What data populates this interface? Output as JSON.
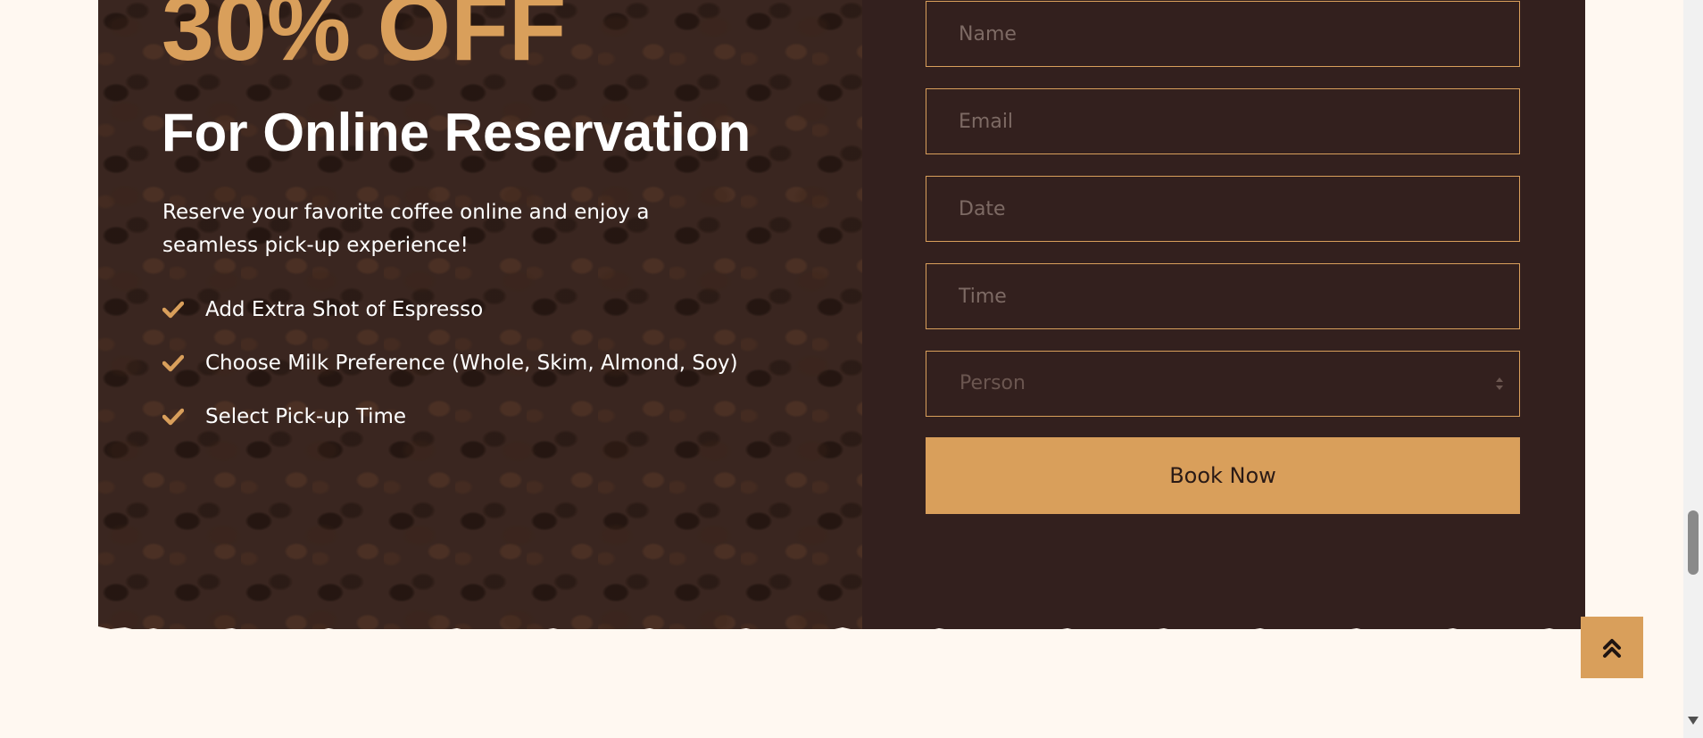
{
  "promo": {
    "headline": "30% OFF",
    "subheadline": "For Online Reservation",
    "description": "Reserve your favorite coffee online and enjoy a seamless pick-up experience!",
    "features": [
      "Add Extra Shot of Espresso",
      "Choose Milk Preference (Whole, Skim, Almond, Soy)",
      "Select Pick-up Time"
    ]
  },
  "form": {
    "name_placeholder": "Name",
    "email_placeholder": "Email",
    "date_placeholder": "Date",
    "time_placeholder": "Time",
    "person_selected": "Person",
    "submit_label": "Book Now"
  },
  "icons": {
    "feature_bullet": "check-icon",
    "back_to_top": "chevron-double-up-icon",
    "select_arrows": "sort-arrows-icon"
  },
  "colors": {
    "accent": "#d99f5b",
    "section_background": "#33201e",
    "page_background": "#fff8f1",
    "button_text": "#2a1a16"
  }
}
